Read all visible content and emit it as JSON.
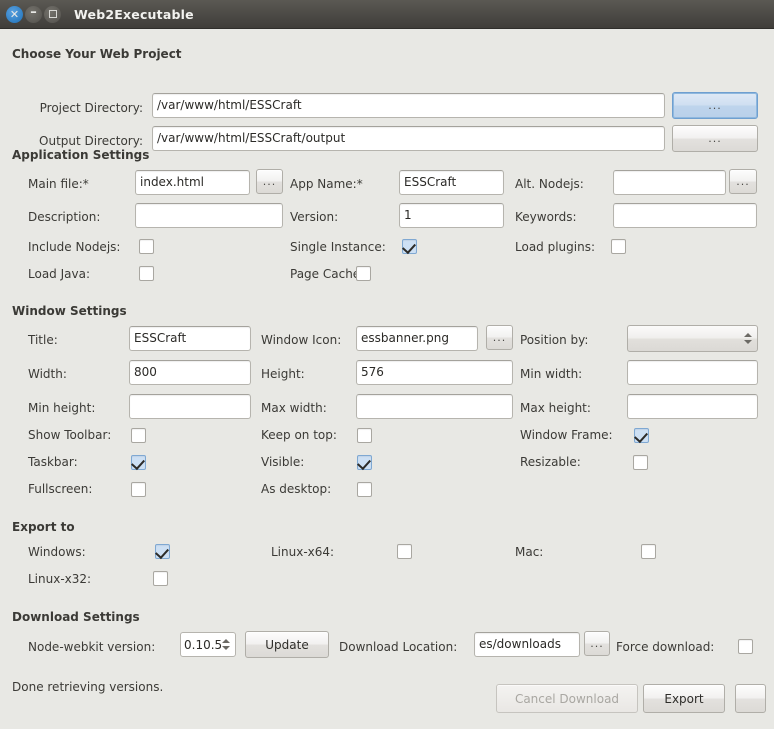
{
  "window": {
    "title": "Web2Executable",
    "controls": [
      {
        "name": "close",
        "glyph": "×"
      },
      {
        "name": "minimize",
        "glyph": "–"
      },
      {
        "name": "maximize",
        "glyph": "□"
      }
    ]
  },
  "sections": {
    "project": {
      "header": "Choose Your Web Project",
      "project_dir_label": "Project Directory:",
      "project_dir_value": "/var/www/html/ESSCraft",
      "project_dir_browse": "...",
      "output_dir_label": "Output Directory:",
      "output_dir_value": "/var/www/html/ESSCraft/output",
      "output_dir_browse": "..."
    },
    "application": {
      "header": "Application Settings",
      "main_file_label": "Main file:*",
      "main_file_value": "index.html",
      "main_file_browse": "...",
      "app_name_label": "App Name:*",
      "app_name_value": "ESSCraft",
      "alt_nodejs_label": "Alt. Nodejs:",
      "alt_nodejs_value": "",
      "alt_nodejs_browse": "...",
      "description_label": "Description:",
      "description_value": "",
      "version_label": "Version:",
      "version_value": "1",
      "keywords_label": "Keywords:",
      "keywords_value": "",
      "include_nodejs_label": "Include Nodejs:",
      "include_nodejs_checked": false,
      "single_instance_label": "Single Instance:",
      "single_instance_checked": true,
      "load_plugins_label": "Load plugins:",
      "load_plugins_checked": false,
      "load_java_label": "Load Java:",
      "load_java_checked": false,
      "page_cache_label": "Page Cache:",
      "page_cache_checked": false
    },
    "window_settings": {
      "header": "Window Settings",
      "title_label": "Title:",
      "title_value": "ESSCraft",
      "window_icon_label": "Window Icon:",
      "window_icon_value": "essbanner.png",
      "window_icon_browse": "...",
      "position_by_label": "Position by:",
      "position_by_value": "",
      "width_label": "Width:",
      "width_value": "800",
      "height_label": "Height:",
      "height_value": "576",
      "min_width_label": "Min width:",
      "min_width_value": "",
      "min_height_label": "Min height:",
      "min_height_value": "",
      "max_width_label": "Max width:",
      "max_width_value": "",
      "max_height_label": "Max height:",
      "max_height_value": "",
      "show_toolbar_label": "Show Toolbar:",
      "show_toolbar_checked": false,
      "keep_on_top_label": "Keep on top:",
      "keep_on_top_checked": false,
      "window_frame_label": "Window Frame:",
      "window_frame_checked": true,
      "taskbar_label": "Taskbar:",
      "taskbar_checked": true,
      "visible_label": "Visible:",
      "visible_checked": true,
      "resizable_label": "Resizable:",
      "resizable_checked": false,
      "fullscreen_label": "Fullscreen:",
      "fullscreen_checked": false,
      "as_desktop_label": "As desktop:",
      "as_desktop_checked": false
    },
    "export": {
      "header": "Export to",
      "windows_label": "Windows:",
      "windows_checked": true,
      "linux_x64_label": "Linux-x64:",
      "linux_x64_checked": false,
      "mac_label": "Mac:",
      "mac_checked": false,
      "linux_x32_label": "Linux-x32:",
      "linux_x32_checked": false
    },
    "download": {
      "header": "Download Settings",
      "node_webkit_label": "Node-webkit version:",
      "node_webkit_value": "0.10.5",
      "update_button": "Update",
      "download_location_label": "Download Location:",
      "download_location_value": "es/downloads",
      "download_location_browse": "...",
      "force_download_label": "Force download:",
      "force_download_checked": false
    }
  },
  "footer": {
    "status": "Done retrieving versions.",
    "cancel_button": "Cancel Download",
    "export_button": "Export",
    "extra_button": ""
  },
  "colors": {
    "titlebar": "#4b4945",
    "background": "#e8e8e4",
    "accent_focus": "#6f9fd0",
    "checkbox_on": "#cde0f4"
  }
}
